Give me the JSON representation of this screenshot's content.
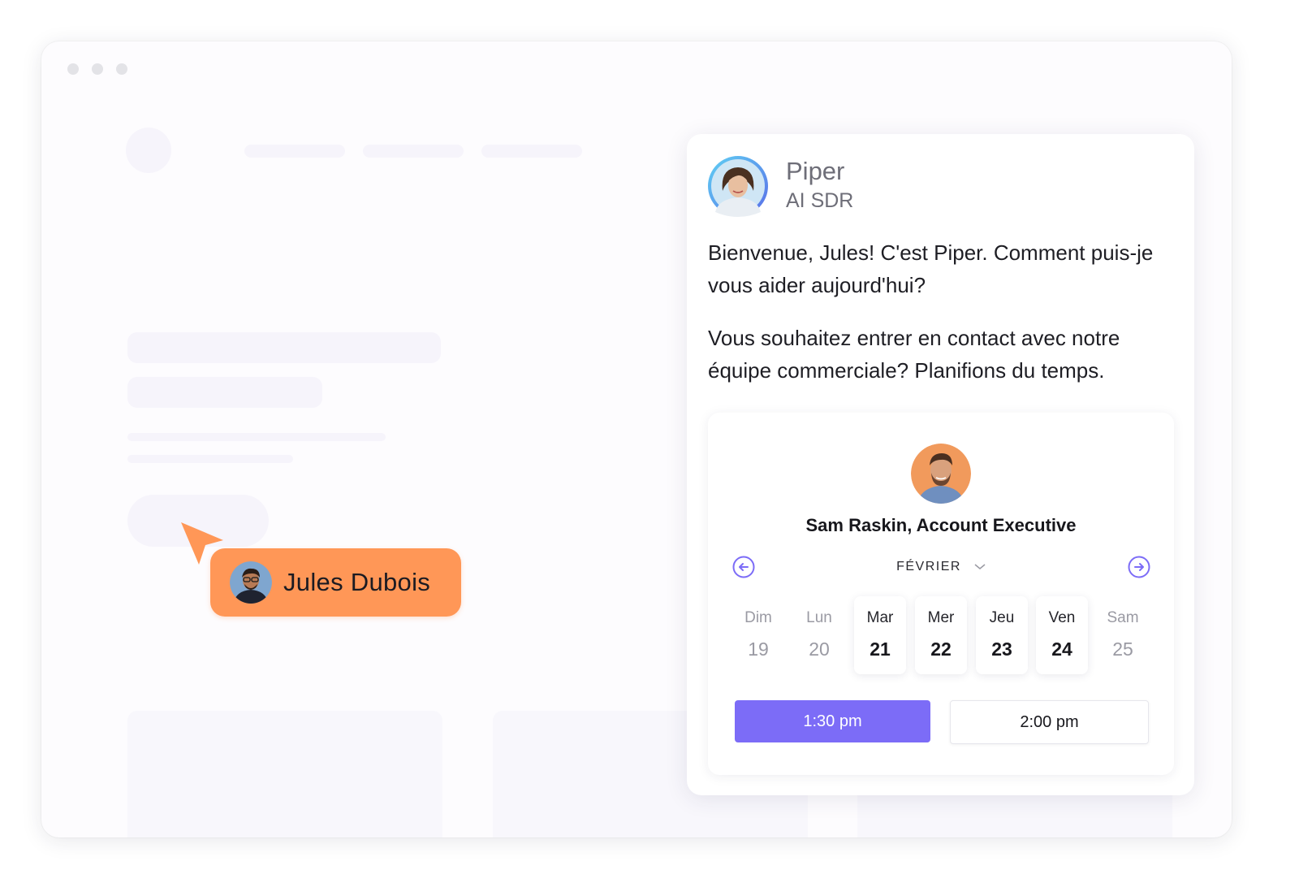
{
  "visitor": {
    "name": "Jules Dubois",
    "tag_color": "#ff9757"
  },
  "assistant": {
    "name": "Piper",
    "role": "AI SDR",
    "messages": [
      "Bienvenue, Jules! C'est Piper. Comment puis-je vous aider aujourd'hui?",
      "Vous souhaitez entrer en contact avec notre équipe commerciale? Planifions du temps."
    ]
  },
  "scheduler": {
    "rep": "Sam Raskin, Account Executive",
    "month": "FÉVRIER",
    "prev_icon": "arrow-left-circle-icon",
    "next_icon": "arrow-right-circle-icon",
    "days": [
      {
        "name": "Dim",
        "date": "19",
        "available": false
      },
      {
        "name": "Lun",
        "date": "20",
        "available": false
      },
      {
        "name": "Mar",
        "date": "21",
        "available": true
      },
      {
        "name": "Mer",
        "date": "22",
        "available": true
      },
      {
        "name": "Jeu",
        "date": "23",
        "available": true
      },
      {
        "name": "Ven",
        "date": "24",
        "available": true
      },
      {
        "name": "Sam",
        "date": "25",
        "available": false
      }
    ],
    "slots": [
      {
        "label": "1:30 pm",
        "selected": true
      },
      {
        "label": "2:00 pm",
        "selected": false
      }
    ],
    "accent": "#7c6cf7"
  }
}
